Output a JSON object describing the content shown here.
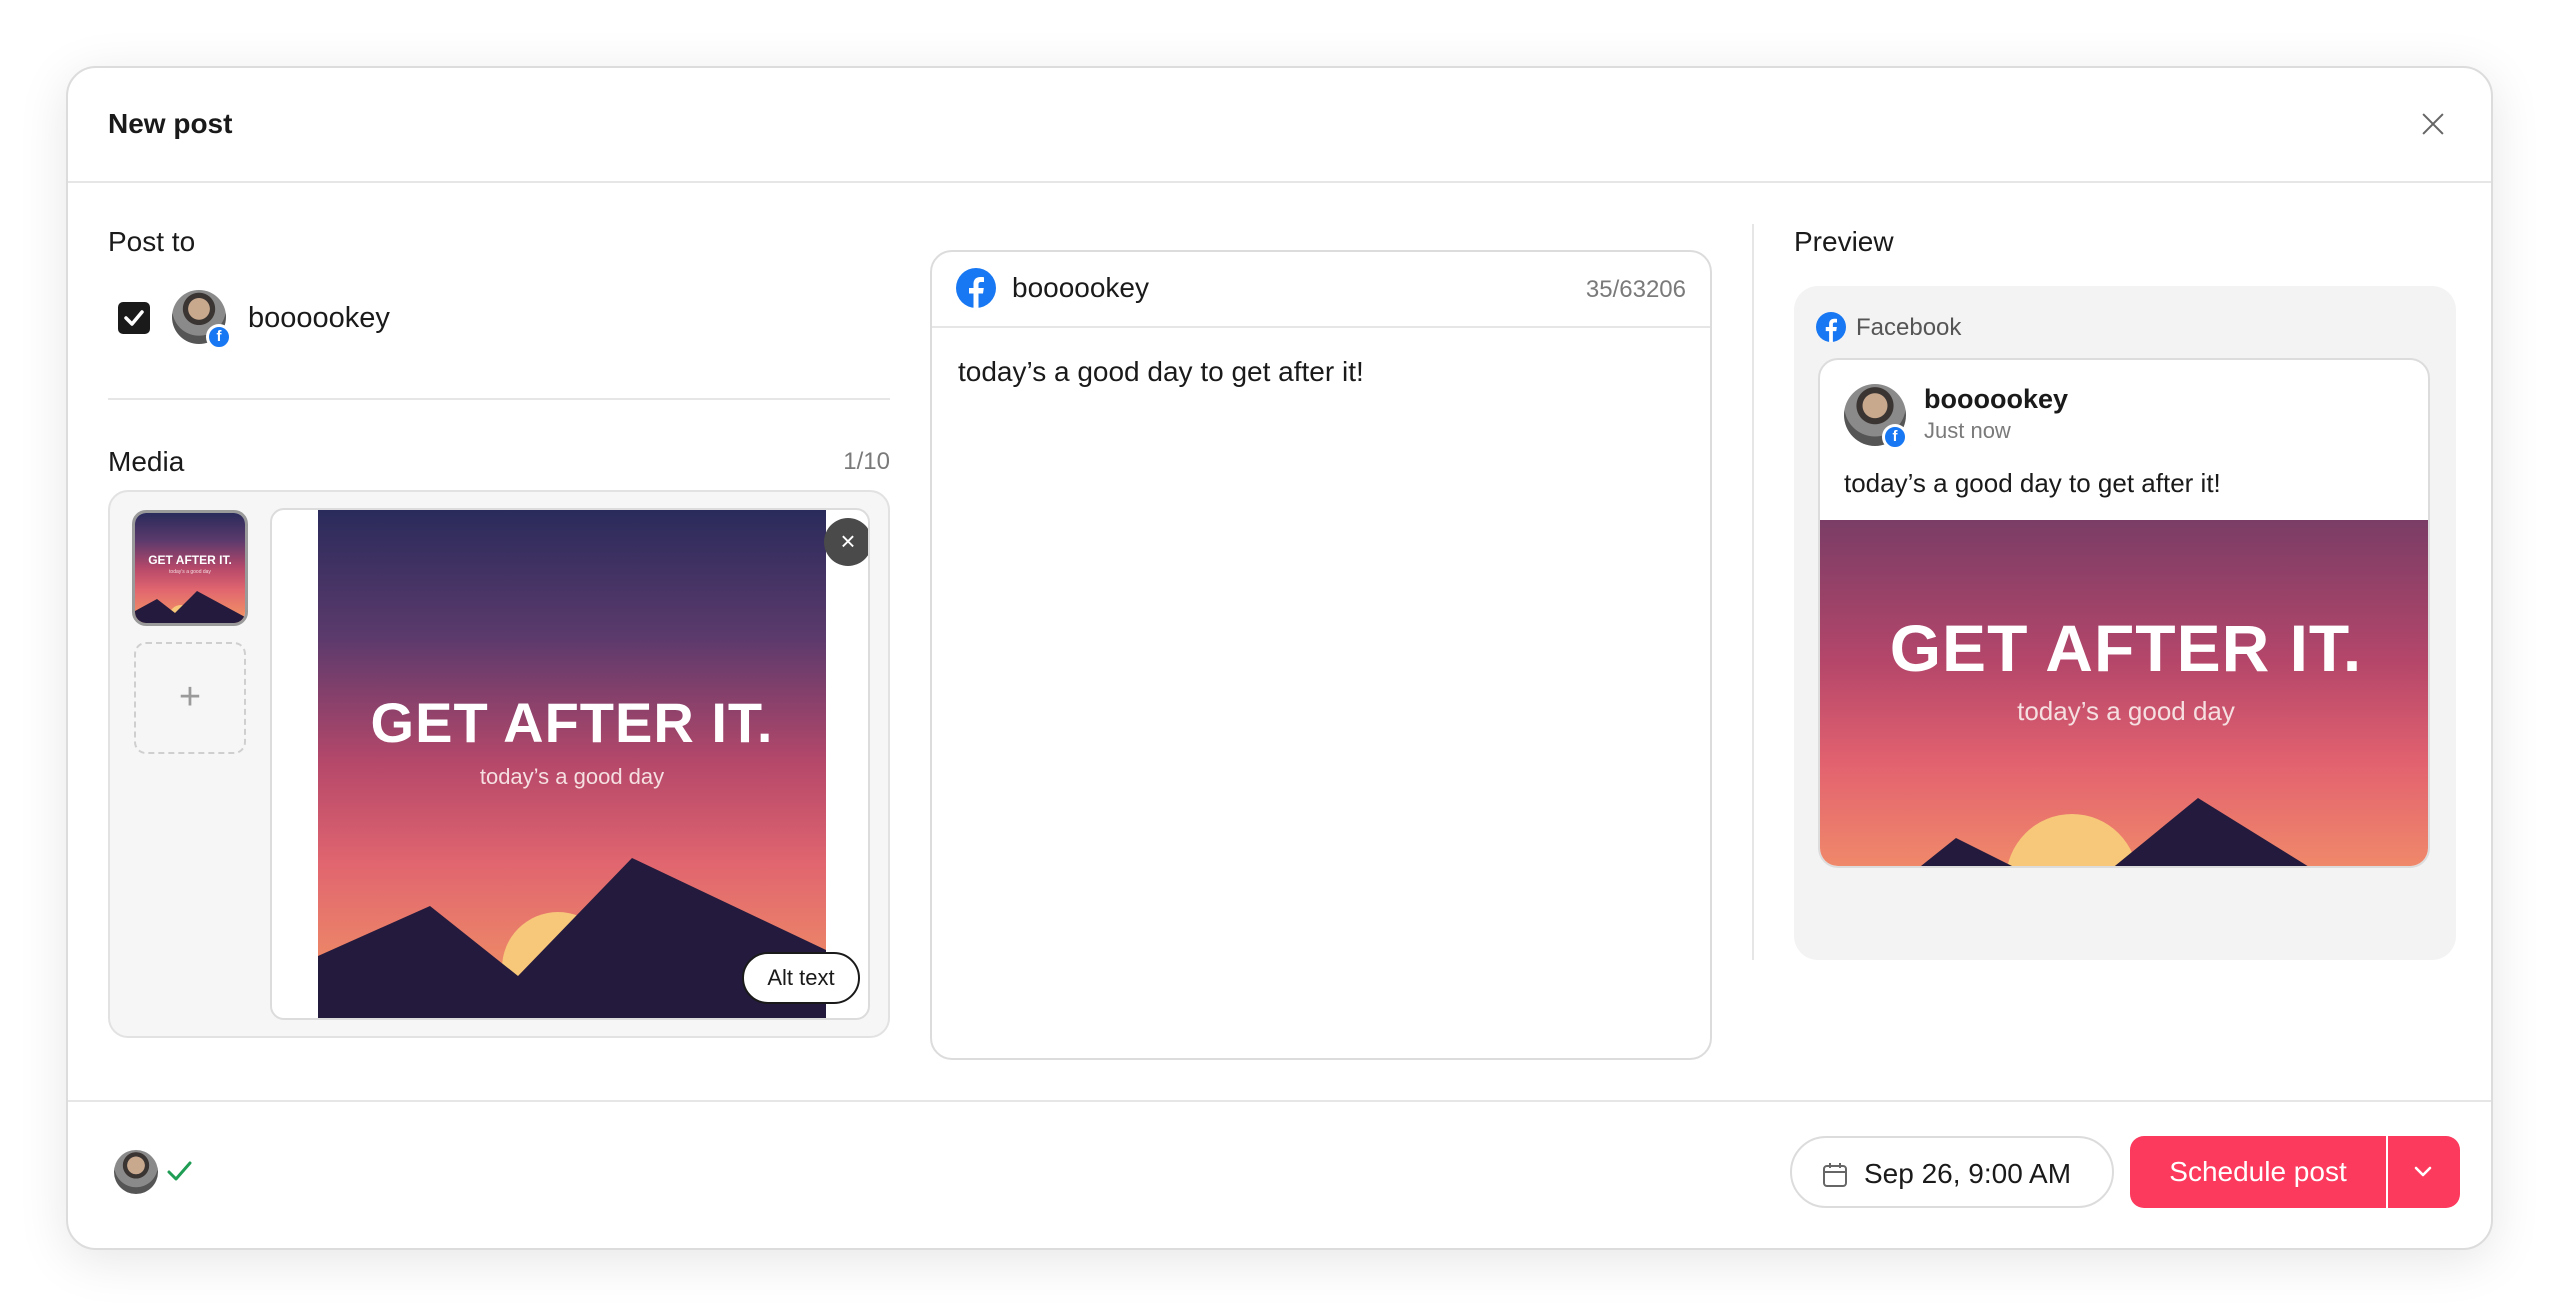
{
  "modal": {
    "title": "New post"
  },
  "post_to": {
    "label": "Post to",
    "accounts": [
      {
        "name": "boooookey",
        "platform": "Facebook",
        "selected": true
      }
    ]
  },
  "media": {
    "label": "Media",
    "count": "1/10",
    "add_label": "+",
    "remove_label": "×",
    "alt_text_label": "Alt text",
    "image": {
      "headline": "GET AFTER IT.",
      "subline": "today’s a good day"
    }
  },
  "editor": {
    "account": "boooookey",
    "char_count": "35/63206",
    "text": "today’s a good day to get after it!"
  },
  "preview": {
    "label": "Preview",
    "platform": "Facebook",
    "card": {
      "name": "boooookey",
      "time": "Just now",
      "text": "today’s a good day to get after it!",
      "image": {
        "headline": "GET AFTER IT.",
        "subline": "today’s a good day"
      }
    }
  },
  "footer": {
    "date": "Sep 26, 9:00 AM",
    "schedule_label": "Schedule post"
  },
  "colors": {
    "accent": "#fb3a5d",
    "facebook": "#1877f2",
    "success": "#1f9d55"
  },
  "icons": [
    "close-icon",
    "facebook-icon",
    "checkbox-checked-icon",
    "calendar-icon",
    "chevron-down-icon",
    "check-icon",
    "plus-icon"
  ]
}
